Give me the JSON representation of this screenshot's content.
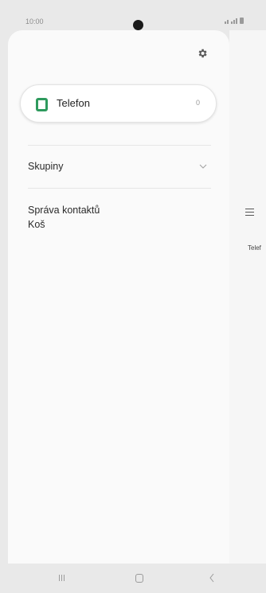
{
  "status_bar": {
    "time": "10:00"
  },
  "drawer": {
    "account": {
      "name": "Telefon",
      "count": "0"
    },
    "menu": [
      {
        "label": "Skupiny"
      },
      {
        "label": "Správa kontaktů"
      },
      {
        "label": "Koš"
      }
    ]
  },
  "background_screen": {
    "label": "Telef"
  },
  "icons": {
    "settings": "gear-icon",
    "menu": "hamburger-icon",
    "expand": "chevron-down-icon",
    "account_app": "phone-app-icon",
    "nav_recents": "recents-icon",
    "nav_home": "home-icon",
    "nav_back": "back-icon"
  },
  "colors": {
    "accent_green": "#2e9a5d",
    "drawer_bg": "#fafafa",
    "frame_bg": "#e9e9e9"
  }
}
